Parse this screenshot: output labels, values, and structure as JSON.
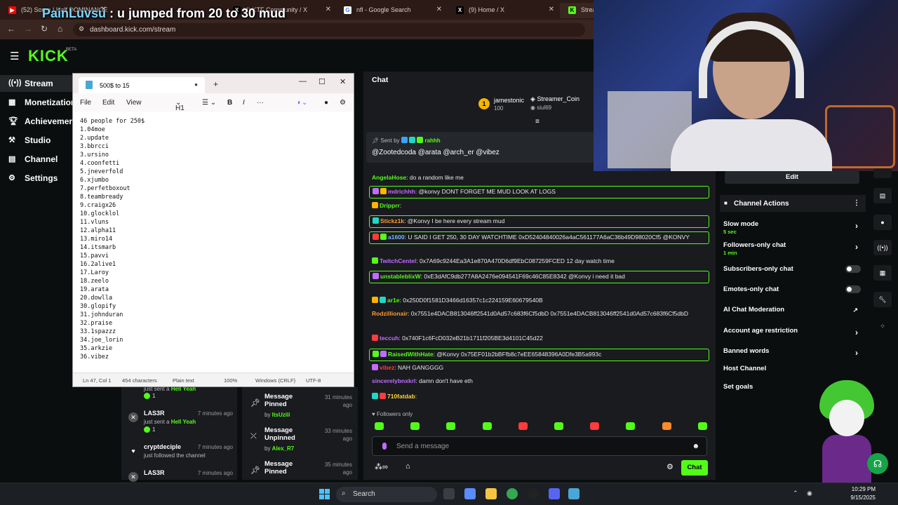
{
  "browser": {
    "tabs": [
      {
        "label": "(52) Soren | Half DOMINANCE",
        "icon": "youtube-icon"
      },
      {
        "label": "(4) KTF Community / X",
        "icon": "x-icon"
      },
      {
        "label": "nfl - Google Search",
        "icon": "google-icon"
      },
      {
        "label": "(9) Home / X",
        "icon": "x-icon"
      },
      {
        "label": "Stream",
        "icon": "kick-icon"
      }
    ],
    "url": "dashboard.kick.com/stream"
  },
  "overlay": {
    "username": "PainLuvsu",
    "message": " : u jumped from 20 to 30 mud"
  },
  "kick": {
    "logo": "KICK",
    "beta": "BETA"
  },
  "sidebar": {
    "items": [
      {
        "label": "Stream",
        "icon": "stream-icon"
      },
      {
        "label": "Monetization",
        "icon": "monetization-icon"
      },
      {
        "label": "Achievements",
        "icon": "trophy-icon"
      },
      {
        "label": "Studio",
        "icon": "studio-icon"
      },
      {
        "label": "Channel",
        "icon": "channel-icon"
      },
      {
        "label": "Settings",
        "icon": "gear-icon"
      }
    ]
  },
  "notepad": {
    "tab_title": "500$ to 15",
    "menu": {
      "file": "File",
      "edit": "Edit",
      "view": "View",
      "heading": "H1"
    },
    "lines": [
      "46 people for 250$",
      "1.04moe",
      "2.update",
      "3.bbrcci",
      "3.ursino",
      "4.coonfetti",
      "5.jneverfold",
      "6.xjumbo",
      "7.perfetboxout",
      "8.teambready",
      "9.craigx26",
      "10.glocklol",
      "11.vluns",
      "12.alpha11",
      "13.miro14",
      "14.itsmarb",
      "15.pavvi",
      "16.2alive1",
      "17.Laroy",
      "18.zeelo",
      "19.arata",
      "20.dowlla",
      "30.glopify",
      "31.johnduran",
      "32.praise",
      "33.1spazzz",
      "34.joe_lorin",
      "35.arkzie",
      "36.vibez"
    ],
    "status": {
      "position": "Ln 47, Col 1",
      "chars": "454 characters",
      "format": "Plain text",
      "zoom": "100%",
      "eol": "Windows (CRLF)",
      "enc": "UTF-8"
    }
  },
  "activity": {
    "items": [
      {
        "name": "",
        "time": "",
        "sub_prefix": "just sent a ",
        "sub_em": "Hell Yeah",
        "count": "1"
      },
      {
        "name": "LAS3R",
        "time": "7 minutes ago",
        "sub_prefix": "just sent a ",
        "sub_em": "Hell Yeah",
        "count": "1"
      },
      {
        "name": "cryptdeciple",
        "time": "7 minutes ago",
        "sub": "just followed the channel"
      },
      {
        "name": "LAS3R",
        "time": "7 minutes ago"
      }
    ]
  },
  "mod_log": {
    "items": [
      {
        "title": "Message Pinned",
        "time": "31 minutes ago",
        "by": "ItsUzili"
      },
      {
        "title": "Message Unpinned",
        "time": "33 minutes ago",
        "by": "Alex_R7"
      },
      {
        "title": "Message Pinned",
        "time": "35 minutes ago"
      }
    ],
    "by_label": "by "
  },
  "chat": {
    "title": "Chat",
    "leaders": [
      {
        "name": "jamestonic",
        "value": "100"
      },
      {
        "name": "Streamer_Coin",
        "value": "siul69"
      }
    ],
    "pinned": {
      "sent_by": "Sent by",
      "user": "rahhh",
      "message": "@Zootedcoda @arata @arch_er @vibez"
    },
    "messages": [
      {
        "user": "AngelaHose",
        "color": "#53fc18",
        "text": "do a random like me",
        "hl": false
      },
      {
        "user": "mdrichhh",
        "color": "#c26bff",
        "text": "@konvy DONT FORGET ME MUD LOOK AT LOGS",
        "hl": true
      },
      {
        "user": "Dripprr",
        "color": "#53fc18",
        "text": "",
        "hl": false
      },
      {
        "user": "Stickz1k",
        "color": "#ff9a2e",
        "text": "@Konvy I be here every stream mud",
        "hl": true
      },
      {
        "user": "a1600",
        "color": "#7ab8ff",
        "text": "U SAID I GET 250, 30 DAY WATCHTIME 0xD52404840026a4aC561177A6aC36b49D98020Cf5 @KONVY",
        "hl": true
      },
      {
        "user": "TwitchCentel",
        "color": "#c26bff",
        "text": "0x7A69c9244Ea3A1e870A470D6df9EbC087259FCED 12 day watch time",
        "hl": false
      },
      {
        "user": "unstableblixW",
        "color": "#53fc18",
        "text": "0xE3dAfC9db277A8A2476e094541F69c46C85E8342 @Konvy i need it bad",
        "hl": true
      },
      {
        "user": "ar1e",
        "color": "#53fc18",
        "text": "0x250D0f1581D3466d16357c1c224159E60679540B",
        "hl": false
      },
      {
        "user": "Rodzillionair",
        "color": "#ff9a2e",
        "text": "0x7551e4DACB813046ff2541d0Ad57c683f6Cf5dbD 0x7551e4DACB813046ff2541d0Ad57c683f6Cf5dbD",
        "hl": false
      },
      {
        "user": "teccuh",
        "color": "#c26bff",
        "text": "0x740F1c6FcD032eB21b1711f205BE3d4101C45d22",
        "hl": false
      },
      {
        "user": "RaisedWithHate",
        "color": "#53fc18",
        "text": "@Konvy 0x75EF01b2bBFfb8c7eEE65848396A0Dfe3B5a993c",
        "hl": true
      },
      {
        "user": "vibez",
        "color": "#ff3b3b",
        "text": "NAH GANGGGG",
        "hl": false
      },
      {
        "user": "sincerelybnxkrl",
        "color": "#c26bff",
        "text": "damn don't have eth",
        "hl": false
      },
      {
        "user": "710fatdab",
        "color": "#ffd23f",
        "text": "",
        "hl": false
      }
    ],
    "followers_only": "Followers only",
    "input_placeholder": "Send a message",
    "send_button": "Chat"
  },
  "right_panel": {
    "edit": "Edit",
    "channel_actions": "Channel Actions",
    "rows": [
      {
        "label": "Slow mode",
        "sub": "5 sec",
        "control": "chevron"
      },
      {
        "label": "Followers-only chat",
        "sub": "1 min",
        "control": "chevron"
      },
      {
        "label": "Subscribers-only chat",
        "control": "toggle"
      },
      {
        "label": "Emotes-only chat",
        "control": "toggle"
      },
      {
        "label": "AI Chat Moderation",
        "control": "external"
      },
      {
        "label": "Account age restriction",
        "control": "chevron"
      },
      {
        "label": "Banned words",
        "control": "chevron"
      },
      {
        "label": "Host Channel",
        "control": "none"
      },
      {
        "label": "Set goals",
        "control": "none"
      }
    ]
  },
  "taskbar": {
    "search": "Search",
    "time": "10:29 PM",
    "date": "9/15/2025"
  },
  "colors": {
    "accent": "#53fc18",
    "background": "#0b0e0f",
    "panel": "#191b1f"
  }
}
